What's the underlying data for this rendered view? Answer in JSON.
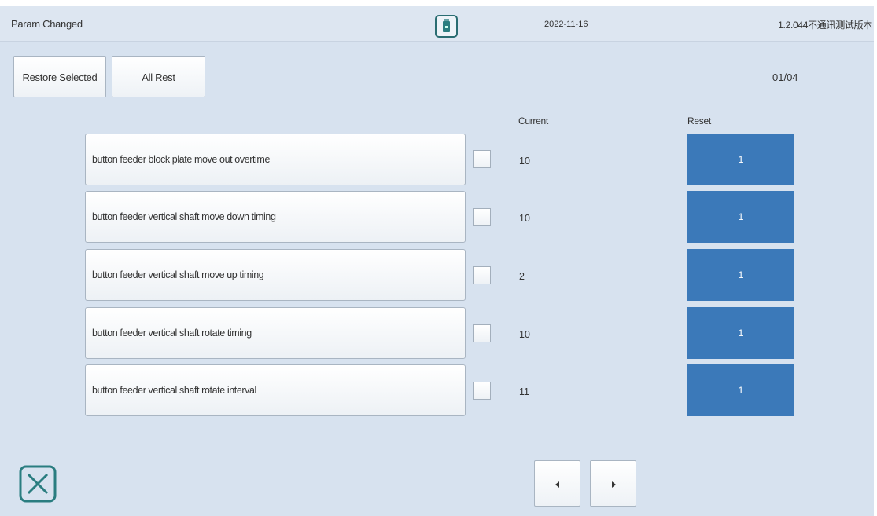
{
  "header": {
    "title": "Param Changed",
    "usb_icon": "usb-drive-icon",
    "date": "2022-11-16",
    "version": "1.2.044不通讯测试版本"
  },
  "toolbar": {
    "restore_selected_label": "Restore Selected",
    "all_rest_label": "All Rest",
    "page_indicator": "01/04"
  },
  "columns": {
    "current": "Current",
    "reset": "Reset"
  },
  "rows": [
    {
      "name": "button feeder block plate move out overtime",
      "checked": false,
      "current": "10",
      "reset": "1"
    },
    {
      "name": "button feeder vertical shaft move down timing",
      "checked": false,
      "current": "10",
      "reset": "1"
    },
    {
      "name": "button feeder vertical shaft move up timing",
      "checked": false,
      "current": "2",
      "reset": "1"
    },
    {
      "name": "button feeder vertical shaft rotate timing",
      "checked": false,
      "current": "10",
      "reset": "1"
    },
    {
      "name": "button feeder vertical shaft rotate interval",
      "checked": false,
      "current": "11",
      "reset": "1"
    }
  ],
  "footer": {
    "close_icon": "close-x-icon",
    "prev_icon": "triangle-left-icon",
    "next_icon": "triangle-right-icon"
  },
  "colors": {
    "background": "#d7e2ef",
    "reset_button": "#3b79b9",
    "close_icon": "#2a7d80"
  }
}
